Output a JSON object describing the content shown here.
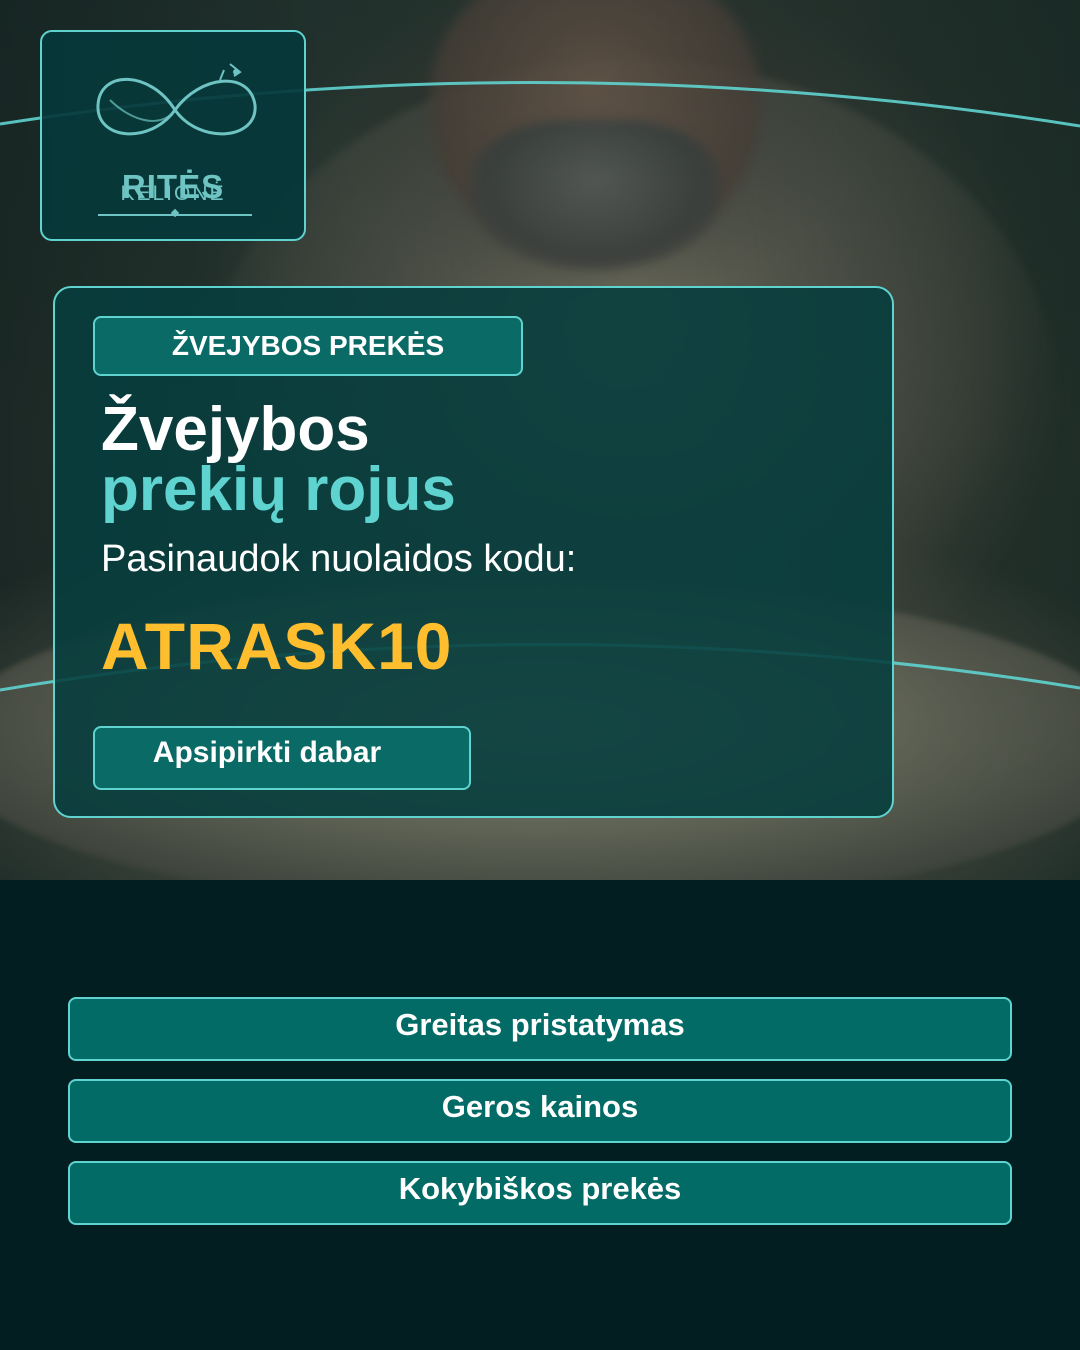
{
  "brand": {
    "name_line1": "RITĖS",
    "name_line2": "KELIONĖ",
    "logo_icon": "infinity-fishing-line-icon"
  },
  "promo": {
    "category": "ŽVEJYBOS PREKĖS",
    "headline_line1": "Žvejybos",
    "headline_line2": "prekių rojus",
    "discount_label": "Pasinaudok nuolaidos kodu:",
    "discount_code": "ATRASK10",
    "cta_label": "Apsipirkti dabar"
  },
  "features": [
    {
      "label": "Greitas pristatymas"
    },
    {
      "label": "Geros kainos"
    },
    {
      "label": "Kokybiškos prekės"
    }
  ],
  "colors": {
    "accent_teal": "#5fd3cf",
    "code_yellow": "#ffbe2e",
    "panel_dark": "#031e20",
    "button_teal": "#036b66"
  }
}
